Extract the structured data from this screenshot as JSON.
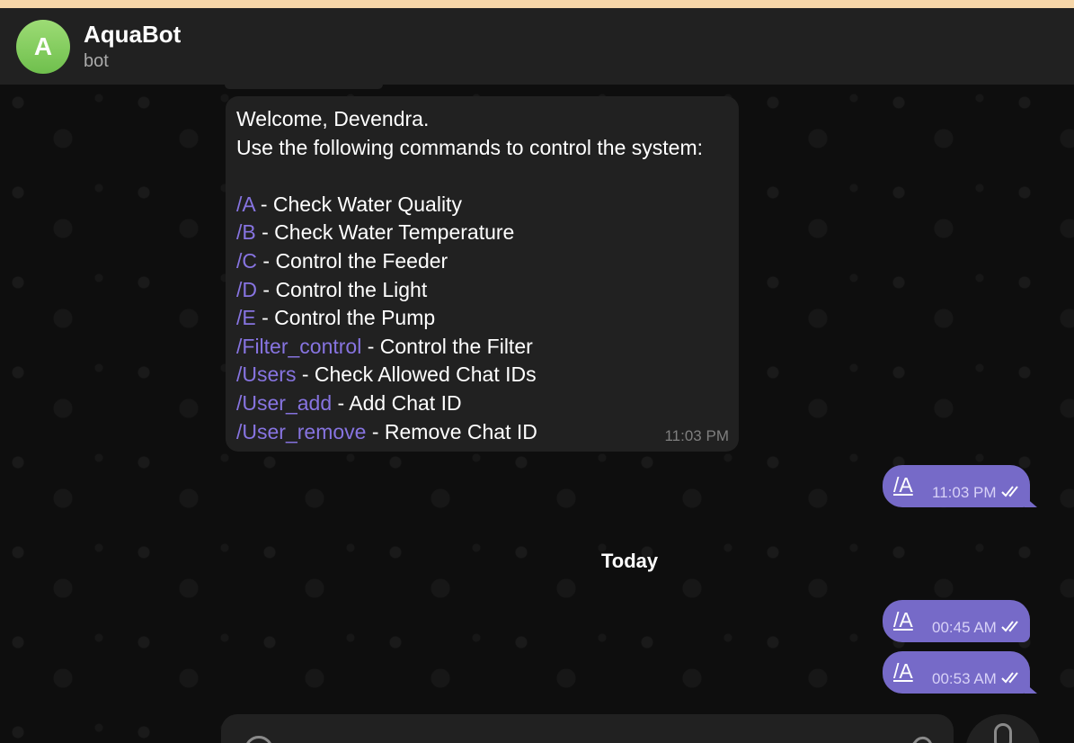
{
  "header": {
    "avatar_letter": "A",
    "title": "AquaBot",
    "status": "bot"
  },
  "bot_message": {
    "greeting": "Welcome, Devendra.",
    "instruction": "Use the following commands to control the system:",
    "commands": [
      {
        "cmd": "/A",
        "desc": " - Check Water Quality"
      },
      {
        "cmd": "/B",
        "desc": " - Check Water Temperature"
      },
      {
        "cmd": "/C",
        "desc": " - Control the Feeder"
      },
      {
        "cmd": "/D",
        "desc": " - Control the Light"
      },
      {
        "cmd": "/E",
        "desc": " - Control the Pump"
      },
      {
        "cmd": "/Filter_control",
        "desc": " - Control the Filter"
      },
      {
        "cmd": "/Users",
        "desc": " - Check Allowed Chat IDs"
      },
      {
        "cmd": "/User_add",
        "desc": " - Add Chat ID"
      },
      {
        "cmd": "/User_remove",
        "desc": " - Remove Chat ID"
      }
    ],
    "time": "11:03 PM"
  },
  "outgoing": [
    {
      "text": "/A",
      "time": "11:03 PM"
    },
    {
      "text": "/A",
      "time": "00:45 AM"
    },
    {
      "text": "/A",
      "time": "00:53 AM"
    }
  ],
  "date_separator": "Today",
  "icons": {
    "emoji": "smile-icon",
    "attach": "paperclip-icon",
    "mic": "microphone-icon",
    "read": "double-check-icon"
  },
  "colors": {
    "accent": "#766ac8",
    "link": "#8774e1",
    "bubble": "#212121",
    "background": "#0e0e0e"
  }
}
